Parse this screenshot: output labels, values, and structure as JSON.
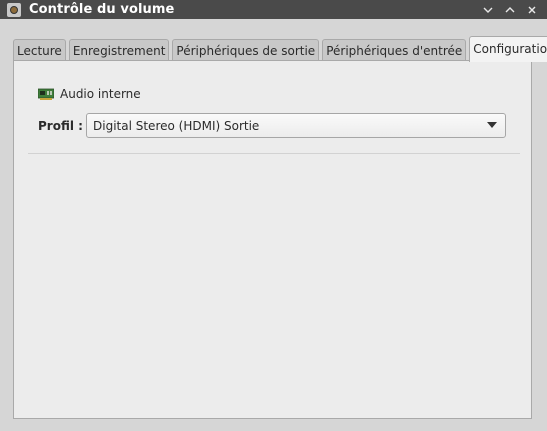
{
  "window": {
    "title": "Contrôle du volume"
  },
  "tabs": [
    {
      "label": "Lecture",
      "active": false
    },
    {
      "label": "Enregistrement",
      "active": false
    },
    {
      "label": "Périphériques de sortie",
      "active": false
    },
    {
      "label": "Périphériques d'entrée",
      "active": false
    },
    {
      "label": "Configuration",
      "active": true
    }
  ],
  "configuration": {
    "device_name": "Audio interne",
    "device_icon": "audio-card-icon",
    "profile_label": "Profil :",
    "profile_value": "Digital Stereo (HDMI) Sortie"
  },
  "colors": {
    "titlebar": "#4a4a4a",
    "window_bg": "#d6d6d6",
    "panel_bg": "#ececec"
  }
}
